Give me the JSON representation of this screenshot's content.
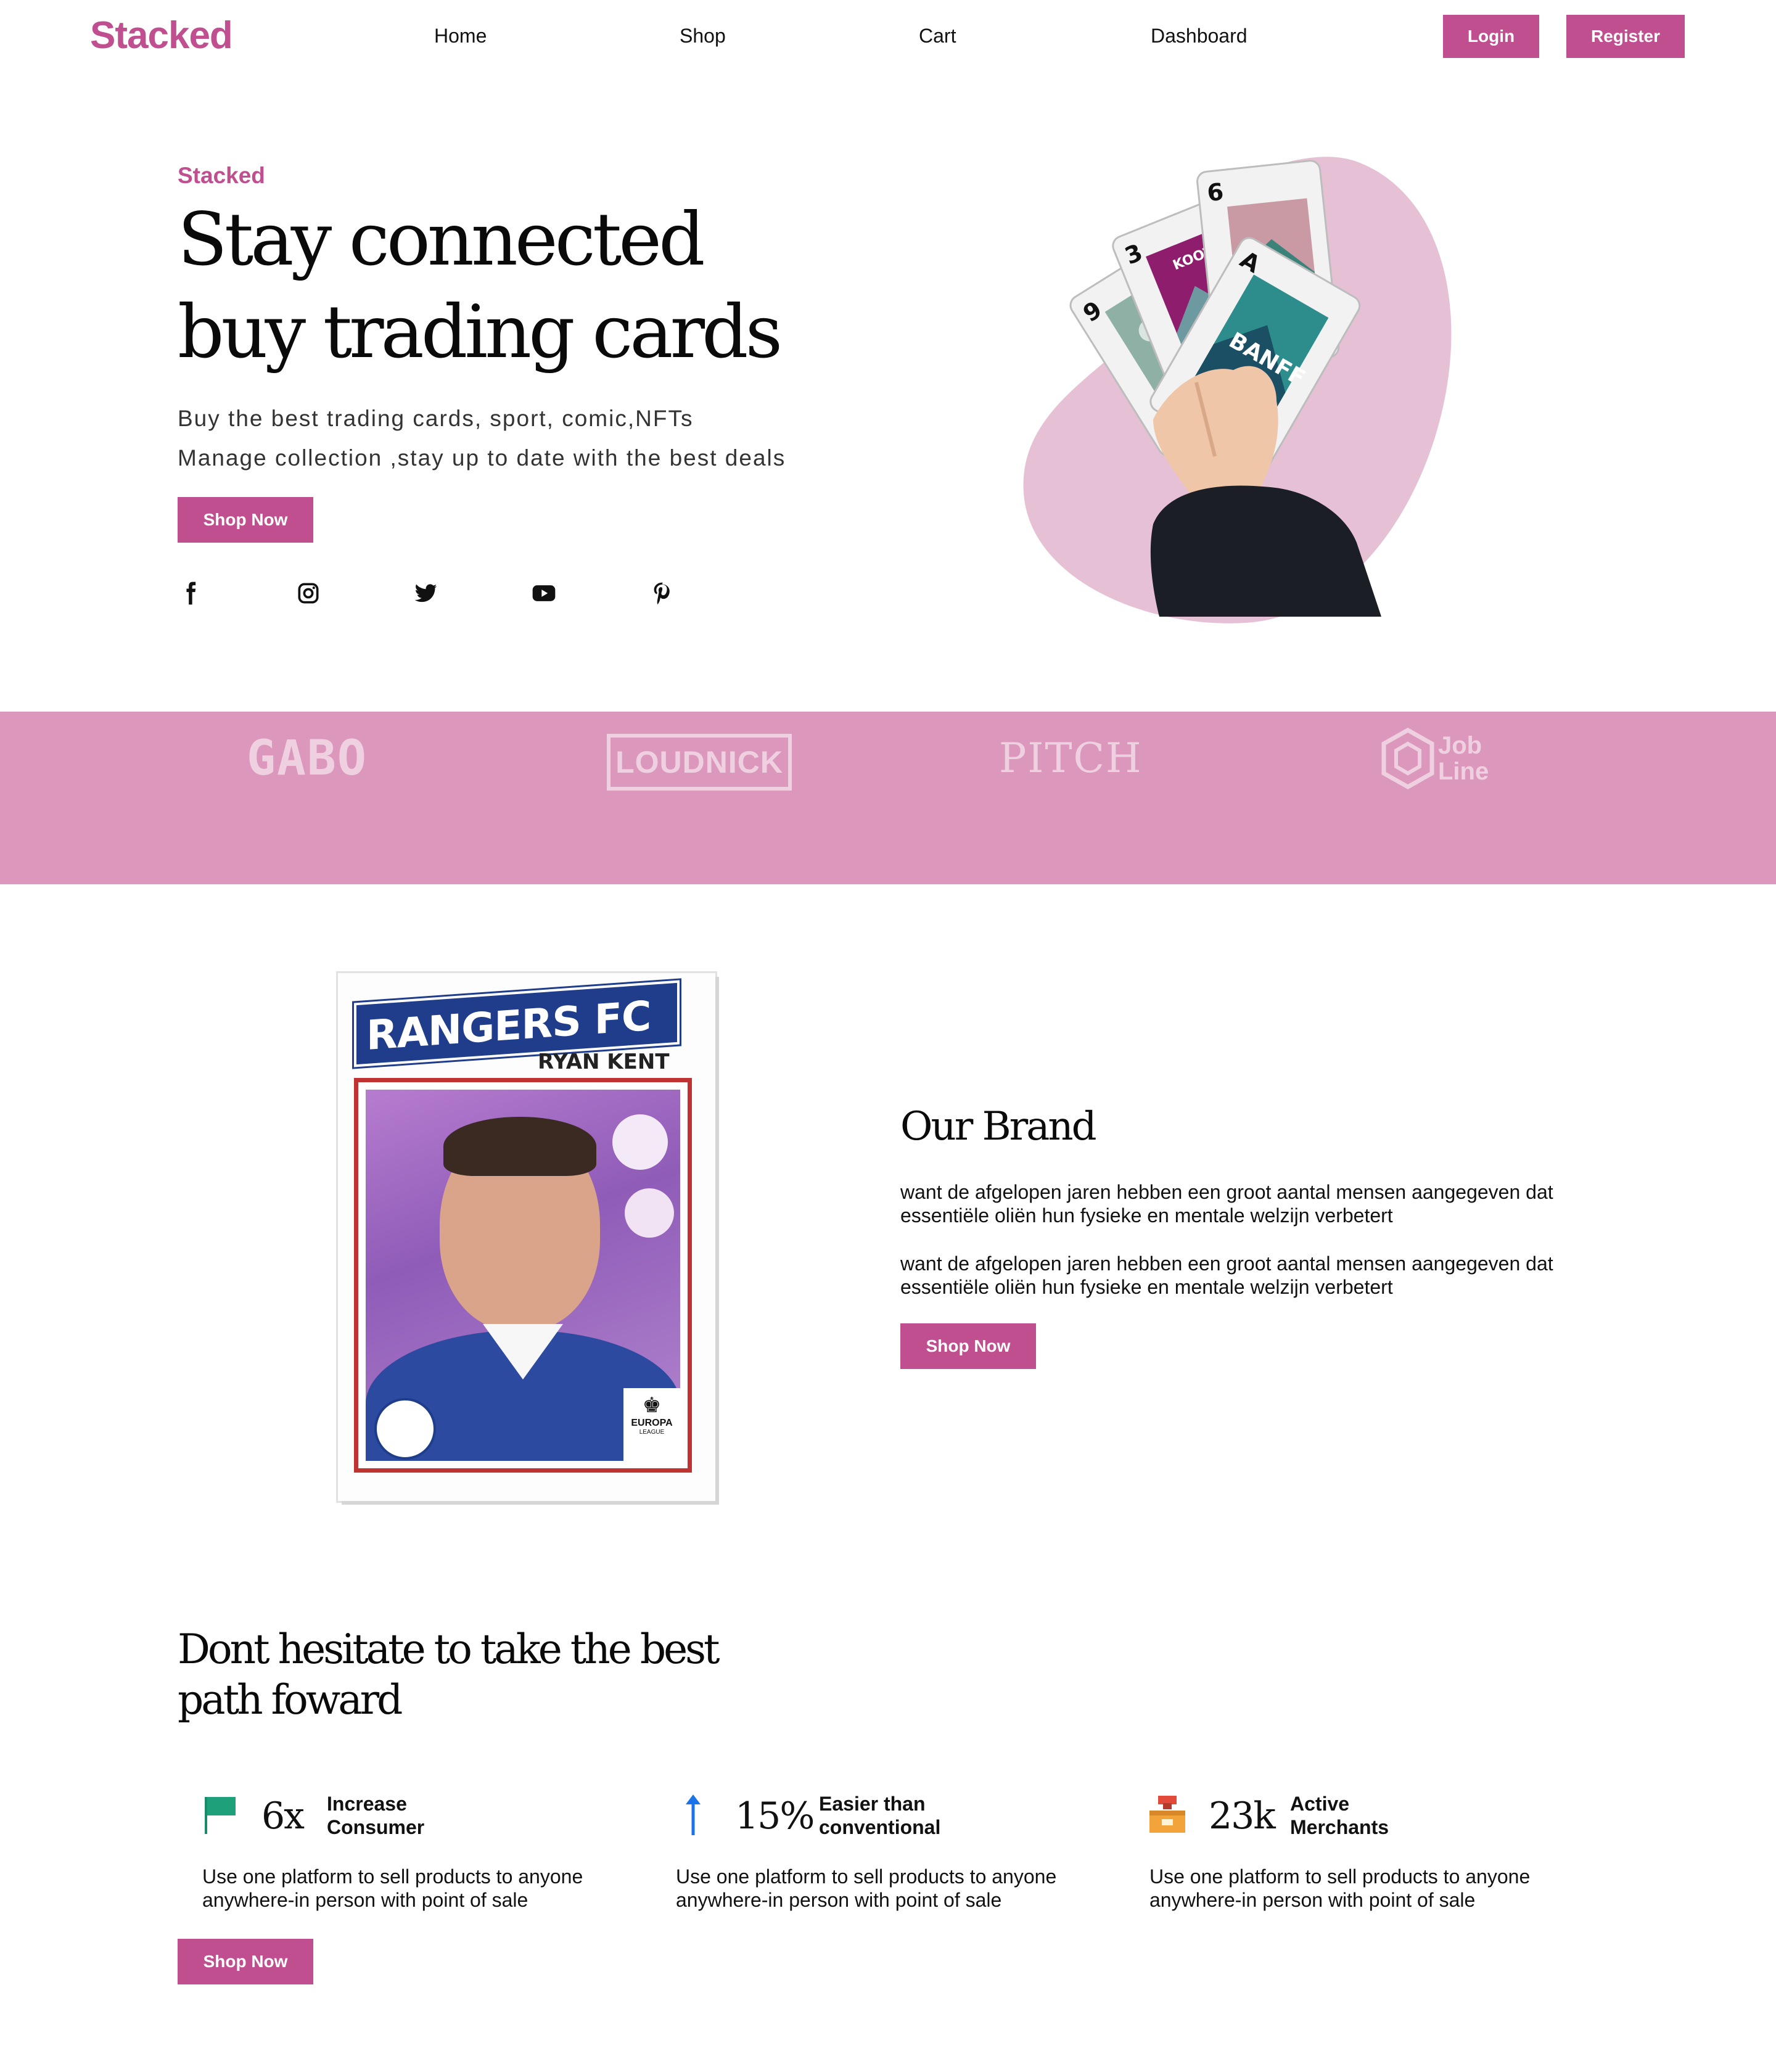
{
  "header": {
    "logo": "Stacked",
    "nav": [
      "Home",
      "Shop",
      "Cart",
      "Dashboard"
    ],
    "login_label": "Login",
    "register_label": "Register"
  },
  "hero": {
    "eyebrow": "Stacked",
    "title_line1": "Stay connected",
    "title_line2": "buy trading cards",
    "subtitle_line1": "Buy the best trading cards, sport, comic,NFTs",
    "subtitle_line2": "Manage collection ,stay up to date with the best deals",
    "cta_label": "Shop Now",
    "socials": [
      "facebook-icon",
      "instagram-icon",
      "twitter-icon",
      "youtube-icon",
      "pinterest-icon"
    ],
    "cards": [
      "9",
      "3",
      "6",
      "A",
      "KOOT",
      "BANFF"
    ]
  },
  "partners": {
    "logos": [
      "GABO",
      "LOUDNICK",
      "PITCH",
      "Job Line"
    ]
  },
  "brand": {
    "card_team": "RANGERS FC",
    "card_player": "RYAN KENT",
    "card_badge": "EUROPA",
    "card_badge_sub": "LEAGUE",
    "title": "Our Brand",
    "paragraph1": "want de afgelopen jaren hebben een groot aantal mensen aangegeven dat essentiële oliën hun fysieke en mentale welzijn verbetert",
    "paragraph2": "want de afgelopen jaren hebben een groot aantal mensen aangegeven dat essentiële oliën hun fysieke en mentale welzijn verbetert",
    "cta_label": "Shop Now"
  },
  "path": {
    "title_line1": "Dont hesitate to take the best",
    "title_line2": "path foward",
    "stats": [
      {
        "icon": "flag-icon",
        "number": "6x",
        "label_line1": "Increase",
        "label_line2": "Consumer",
        "desc_line1": "Use one platform to sell products to anyone",
        "desc_line2": "anywhere-in person with point of sale"
      },
      {
        "icon": "arrow-up-icon",
        "number": "15%",
        "label_line1": "Easier than",
        "label_line2": "conventional",
        "desc_line1": "Use one platform to sell products to anyone",
        "desc_line2": "anywhere-in person with point of sale"
      },
      {
        "icon": "merchant-box-icon",
        "number": "23k",
        "label_line1": "Active",
        "label_line2": "Merchants",
        "desc_line1": "Use one platform to sell products to anyone",
        "desc_line2": "anywhere-in person with point of sale"
      }
    ],
    "cta_label": "Shop Now"
  },
  "colors": {
    "accent": "#c04f90",
    "band": "#dc98bc",
    "blob": "#e6c1d6"
  }
}
